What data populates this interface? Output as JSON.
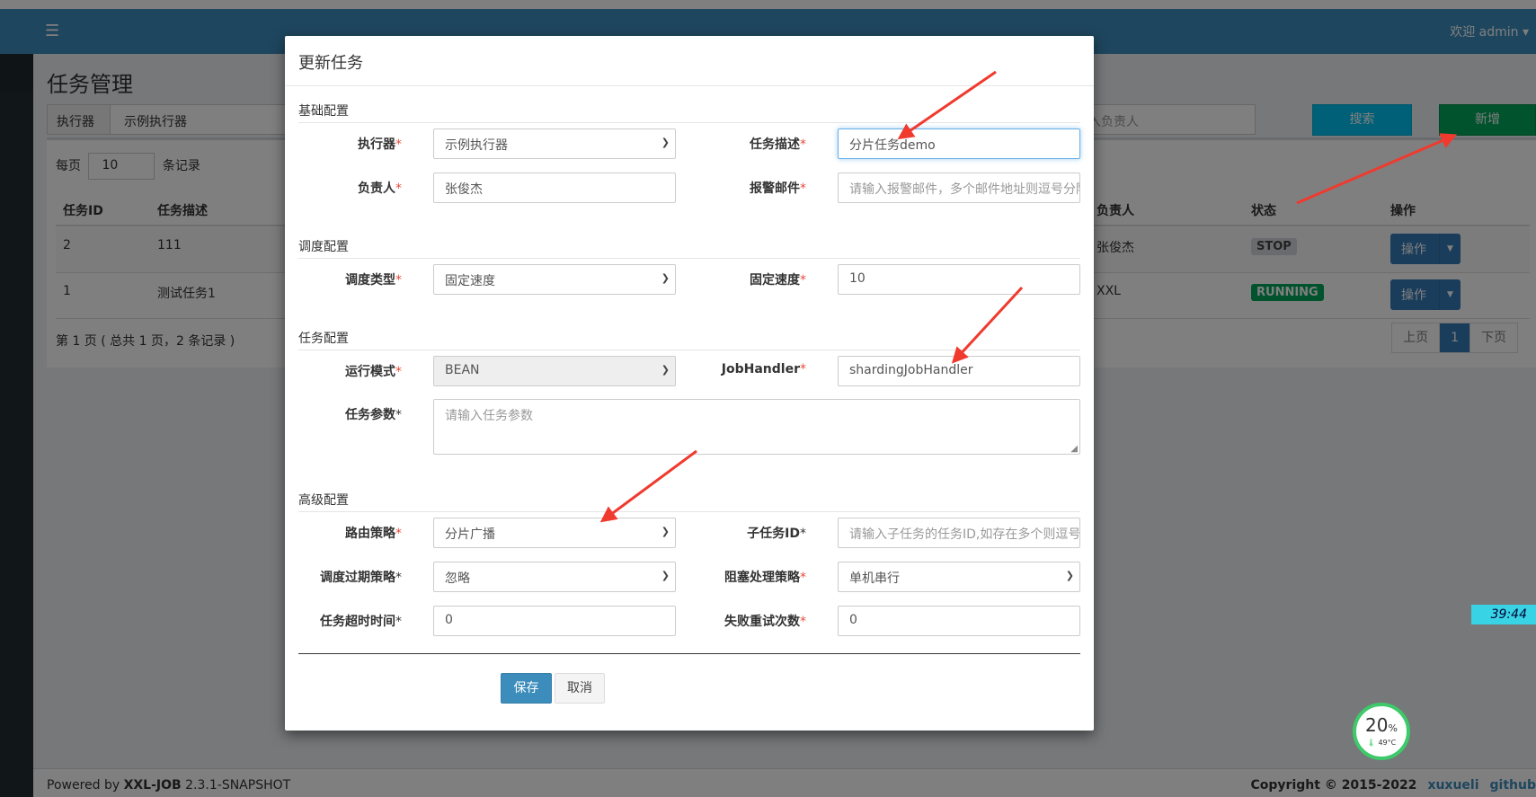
{
  "header": {
    "menu_icon": "hamburger-icon",
    "welcome": "欢迎 admin ▾"
  },
  "page": {
    "title": "任务管理",
    "filter_label": "执行器",
    "filter_value": "示例执行器",
    "owner_placeholder": "请输入负责人",
    "owner_visible": "入负责人",
    "search_button": "搜索",
    "add_button": "新增",
    "length_prefix": "每页",
    "length_value": "10",
    "length_suffix": "条记录",
    "columns": [
      "任务ID",
      "任务描述",
      "负责人",
      "状态",
      "操作"
    ],
    "rows": [
      {
        "id": "2",
        "desc": "111",
        "owner": "张俊杰",
        "status": "STOP",
        "op": "操作"
      },
      {
        "id": "1",
        "desc": "测试任务1",
        "owner": "XXL",
        "status": "RUNNING",
        "op": "操作"
      }
    ],
    "pager_info": "第 1 页 ( 总共 1 页，2 条记录 )",
    "pager": {
      "prev": "上页",
      "current": "1",
      "next": "下页"
    }
  },
  "footer": {
    "powered_prefix": "Powered by ",
    "product": "XXL-JOB",
    "version": " 2.3.1-SNAPSHOT",
    "copyright": "Copyright © 2015-2022",
    "author_link": "xuxueli",
    "github_link": "github"
  },
  "widgets": {
    "timer": "39:44",
    "cpu_percent": "20",
    "cpu_unit": "%",
    "temperature": "49°C"
  },
  "modal": {
    "title": "更新任务",
    "sections": {
      "basic": "基础配置",
      "schedule": "调度配置",
      "task": "任务配置",
      "advanced": "高级配置"
    },
    "fields": {
      "executor": {
        "label": "执行器",
        "value": "示例执行器"
      },
      "job_desc": {
        "label": "任务描述",
        "value": "分片任务demo"
      },
      "author": {
        "label": "负责人",
        "value": "张俊杰"
      },
      "alarm_email": {
        "label": "报警邮件",
        "placeholder": "请输入报警邮件，多个邮件地址则逗号分隔"
      },
      "schedule_type": {
        "label": "调度类型",
        "value": "固定速度"
      },
      "fix_rate": {
        "label": "固定速度",
        "value": "10"
      },
      "run_mode": {
        "label": "运行模式",
        "value": "BEAN"
      },
      "job_handler": {
        "label": "JobHandler",
        "value": "shardingJobHandler"
      },
      "job_param": {
        "label": "任务参数",
        "placeholder": "请输入任务参数"
      },
      "route_strategy": {
        "label": "路由策略",
        "value": "分片广播"
      },
      "child_job_id": {
        "label": "子任务ID",
        "placeholder": "请输入子任务的任务ID,如存在多个则逗号分隔"
      },
      "misfire_strategy": {
        "label": "调度过期策略",
        "value": "忽略"
      },
      "block_strategy": {
        "label": "阻塞处理策略",
        "value": "单机串行"
      },
      "timeout": {
        "label": "任务超时时间",
        "value": "0"
      },
      "fail_retry": {
        "label": "失败重试次数",
        "value": "0"
      }
    },
    "save_button": "保存",
    "cancel_button": "取消"
  },
  "colors": {
    "header": "#3c8dbc",
    "search": "#00c0ef",
    "add": "#00a65a",
    "required": "#e74c3c",
    "arrow": "#f03a2e"
  }
}
